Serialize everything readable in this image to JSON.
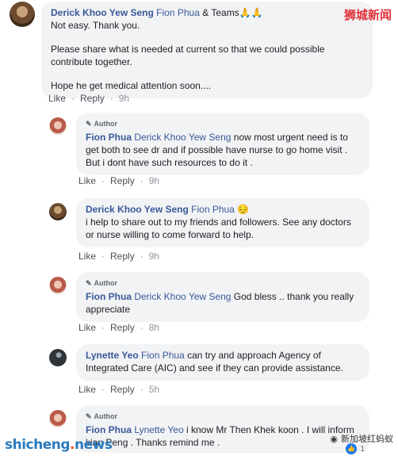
{
  "comments": [
    {
      "name": "Derick Khoo Yew Seng",
      "tag": "Fion Phua",
      "tag_suffix": "& Teams",
      "emoji": "🙏🙏",
      "lines": [
        "Not easy. Thank you.",
        "Please share what is needed at current so that we could possible contribute together.",
        "Hope he get medical attention soon...."
      ],
      "like": "Like",
      "reply": "Reply",
      "time": "9h"
    },
    {
      "author_badge": "Author",
      "name": "Fion Phua",
      "tag": "Derick Khoo Yew Seng",
      "text": "now most urgent need is to get both to see dr and if possible have nurse to go home visit . But i dont have such resources to do it .",
      "like": "Like",
      "reply": "Reply",
      "time": "9h"
    },
    {
      "name": "Derick Khoo Yew Seng",
      "tag": "Fion Phua",
      "emoji": "😔",
      "text": "i help to share out to my friends and followers. See any doctors or nurse willing to come forward to help.",
      "like": "Like",
      "reply": "Reply",
      "time": "9h"
    },
    {
      "author_badge": "Author",
      "name": "Fion Phua",
      "tag": "Derick Khoo Yew Seng",
      "text": "God bless .. thank you really appreciate",
      "like": "Like",
      "reply": "Reply",
      "time": "8h"
    },
    {
      "name": "Lynette Yeo",
      "tag": "Fion Phua",
      "text": "can try and approach Agency of Integrated Care (AIC) and see if they can provide assistance.",
      "like": "Like",
      "reply": "Reply",
      "time": "5h"
    },
    {
      "author_badge": "Author",
      "name": "Fion Phua",
      "tag": "Lynette Yeo",
      "text": "i know Mr Then Khek koon . I will inform kian Peng . Thanks remind me .",
      "reaction_count": "1"
    }
  ],
  "watermarks": {
    "top_right": "狮城新闻",
    "bottom_left_a": "shicheng",
    "bottom_left_dot": ".",
    "bottom_left_b": "news",
    "bottom_right": "新加坡红蚂蚁"
  },
  "colors": {
    "link_blue": "#385898",
    "bubble_bg": "#f2f3f5",
    "meta_gray": "#90949c"
  }
}
